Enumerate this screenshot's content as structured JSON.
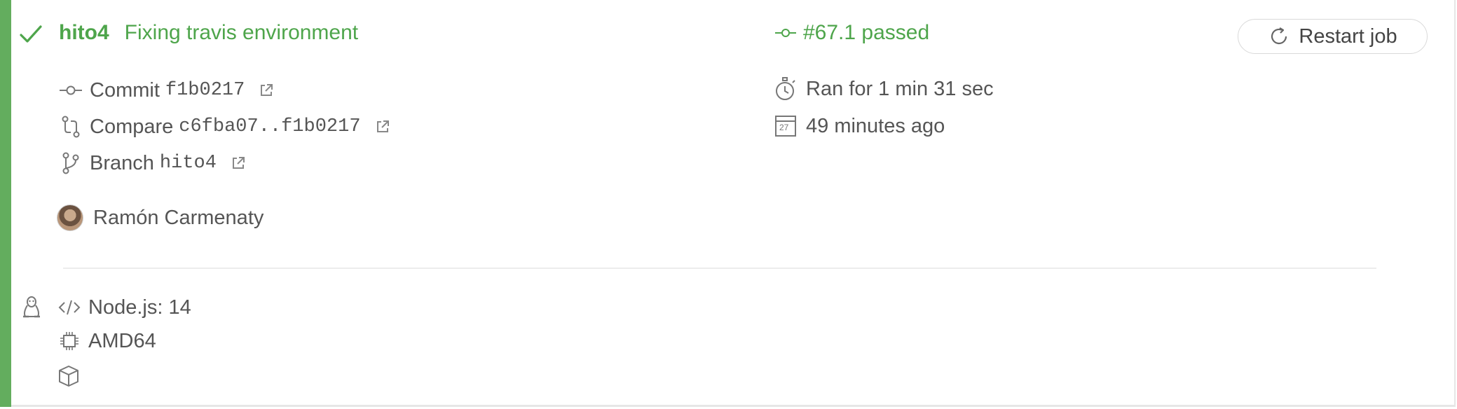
{
  "job": {
    "status_icon": "check-icon",
    "branch_label": "hito4",
    "message": "Fixing travis environment",
    "number_text": "#67.1 passed",
    "restart_label": "Restart job",
    "commit": {
      "label": "Commit",
      "sha": "f1b0217"
    },
    "compare": {
      "label": "Compare",
      "range": "c6fba07..f1b0217"
    },
    "branch": {
      "label": "Branch",
      "name": "hito4"
    },
    "author": "Ramón Carmenaty",
    "duration": "Ran for 1 min 31 sec",
    "finished": "49 minutes ago",
    "calendar_day": "27",
    "language": "Node.js: 14",
    "arch": "AMD64"
  },
  "colors": {
    "passed": "#4ea54b",
    "stripe": "#63ad5e",
    "text": "#555555"
  }
}
